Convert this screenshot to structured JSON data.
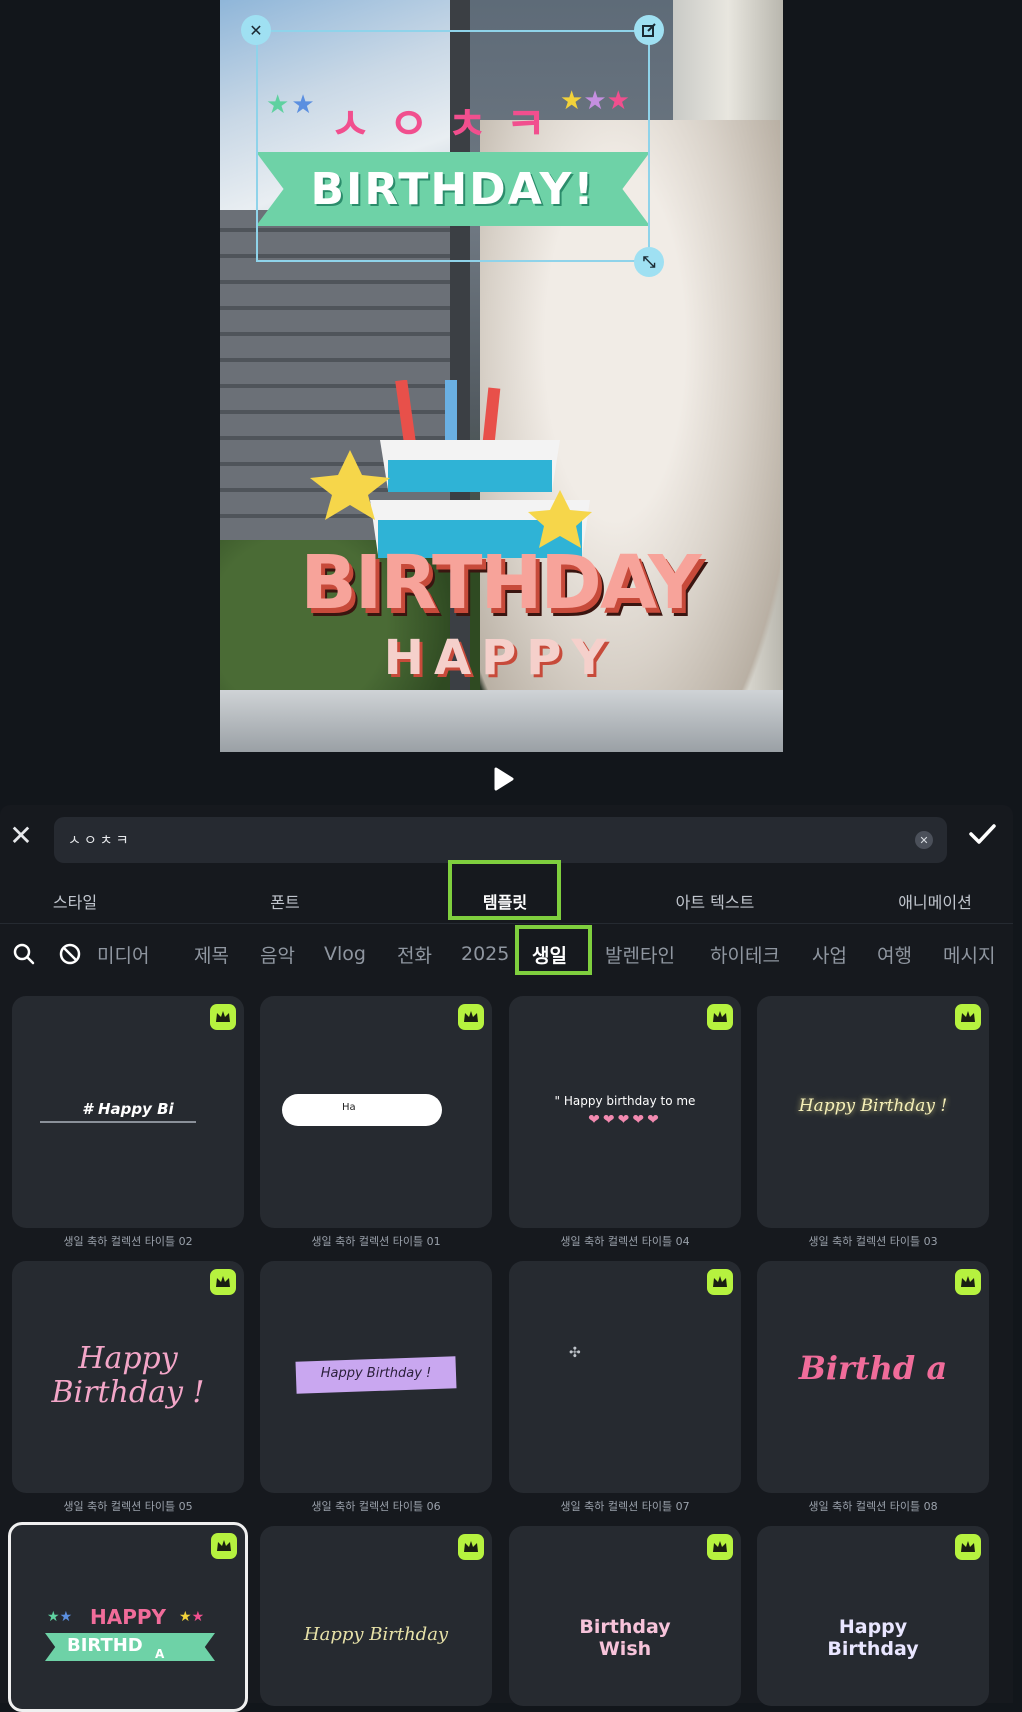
{
  "sticker": {
    "korean_text": "ㅅㅇㅊㅋ",
    "ribbon_text": "BIRTHDAY!",
    "cake_big_text": "BIRTHDAY",
    "cake_small_text": "HAPPY"
  },
  "editor": {
    "input_value": "ㅅㅇㅊㅋ",
    "tabs": [
      "스타일",
      "폰트",
      "템플릿",
      "아트 텍스트",
      "애니메이션"
    ],
    "active_tab": "템플릿",
    "chips": [
      "미디어",
      "제목",
      "음악",
      "Vlog",
      "전화",
      "2025",
      "생일",
      "발렌타인",
      "하이테크",
      "사업",
      "여행",
      "메시지"
    ],
    "active_chip": "생일"
  },
  "templates": [
    {
      "preview": "# Happy Bi",
      "caption": "생일 축하 컬렉션 타이틀 02"
    },
    {
      "preview": "Ha",
      "caption": "생일 축하 컬렉션 타이틀 01"
    },
    {
      "preview": "\" Happy birthday to me",
      "caption": "생일 축하 컬렉션 타이틀 04"
    },
    {
      "preview": "Happy Birthday !",
      "caption": "생일 축하 컬렉션 타이틀 03"
    },
    {
      "preview_line1": "Happy",
      "preview_line2": "Birthday !",
      "caption": "생일 축하 컬렉션 타이틀 05"
    },
    {
      "preview": "Happy Birthday !",
      "caption": "생일 축하 컬렉션 타이틀 06"
    },
    {
      "preview": "",
      "caption": "생일 축하 컬렉션 타이틀 07"
    },
    {
      "preview": "Birthd a",
      "caption": "생일 축하 컬렉션 타이틀 08"
    },
    {
      "preview_line1": "HAPPY",
      "preview_line2": "BIRTHD",
      "preview_line3": "A",
      "caption": ""
    },
    {
      "preview": "Happy Birthday",
      "caption": ""
    },
    {
      "preview_line1": "Birthday",
      "preview_line2": "Wish",
      "caption": ""
    },
    {
      "preview_line1": "Happy",
      "preview_line2": "Birthday",
      "caption": ""
    }
  ],
  "colors": {
    "highlight": "#7fcf3e",
    "premium_badge": "#b6f23f",
    "selection": "#8fd3ea"
  },
  "icons": [
    "close-icon",
    "edit-icon",
    "resize-icon",
    "play-icon",
    "check-icon",
    "search-icon",
    "no-style-icon",
    "crown-icon"
  ]
}
